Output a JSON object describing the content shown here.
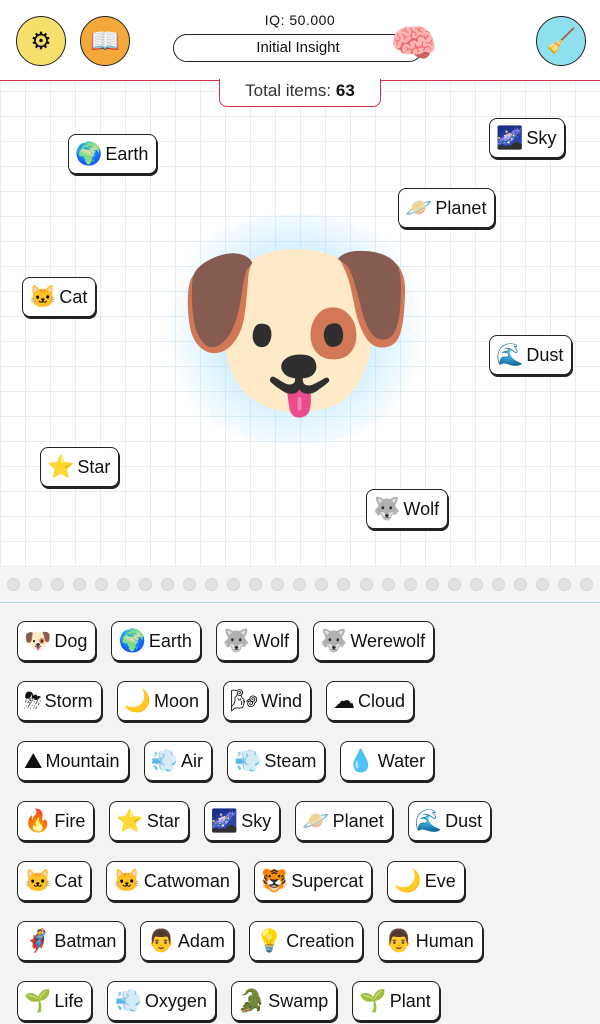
{
  "header": {
    "iq_label": "IQ: 50.000",
    "level": "Initial Insight",
    "settings_icon": "⚙",
    "book_icon": "📖",
    "brain_icon": "🧠",
    "broom_icon": "🧹",
    "colors": {
      "settings": "#f6df6a",
      "book": "#f3a93a",
      "broom": "#8fe0ee",
      "accent": "#d8304a"
    }
  },
  "total": {
    "label": "Total items:",
    "count": "63"
  },
  "canvas": {
    "center_item": {
      "name": "Dog",
      "icon": "🐶"
    },
    "items": [
      {
        "icon": "🌍",
        "label": "Earth"
      },
      {
        "icon": "🌌",
        "label": "Sky"
      },
      {
        "icon": "🪐",
        "label": "Planet"
      },
      {
        "icon": "🐱",
        "label": "Cat"
      },
      {
        "icon": "🌊",
        "label": "Dust"
      },
      {
        "icon": "⭐",
        "label": "Star"
      },
      {
        "icon": "🐺",
        "label": "Wolf"
      }
    ]
  },
  "inventory": {
    "rows": [
      [
        {
          "icon": "🐶",
          "label": "Dog"
        },
        {
          "icon": "🌍",
          "label": "Earth"
        },
        {
          "icon": "🐺",
          "label": "Wolf"
        },
        {
          "icon": "🐺",
          "label": "Werewolf"
        }
      ],
      [
        {
          "icon": "⛈",
          "label": "Storm"
        },
        {
          "icon": "🌙",
          "label": "Moon"
        },
        {
          "icon": "🌬",
          "label": "Wind"
        },
        {
          "icon": "☁",
          "label": "Cloud"
        }
      ],
      [
        {
          "icon": "⛰",
          "label": "Mountain"
        },
        {
          "icon": "💨",
          "label": "Air"
        },
        {
          "icon": "💨",
          "label": "Steam"
        },
        {
          "icon": "💧",
          "label": "Water"
        }
      ],
      [
        {
          "icon": "🔥",
          "label": "Fire"
        },
        {
          "icon": "⭐",
          "label": "Star"
        },
        {
          "icon": "🌌",
          "label": "Sky"
        },
        {
          "icon": "🪐",
          "label": "Planet"
        },
        {
          "icon": "🌊",
          "label": "Dust"
        }
      ],
      [
        {
          "icon": "🐱",
          "label": "Cat"
        },
        {
          "icon": "🐱",
          "label": "Catwoman"
        },
        {
          "icon": "🐯",
          "label": "Supercat"
        },
        {
          "icon": "🌙",
          "label": "Eve"
        }
      ],
      [
        {
          "icon": "🦸",
          "label": "Batman"
        },
        {
          "icon": "👨",
          "label": "Adam"
        },
        {
          "icon": "💡",
          "label": "Creation"
        },
        {
          "icon": "👨",
          "label": "Human"
        }
      ],
      [
        {
          "icon": "🌱",
          "label": "Life"
        },
        {
          "icon": "💨",
          "label": "Oxygen"
        },
        {
          "icon": "🐊",
          "label": "Swamp"
        },
        {
          "icon": "🌱",
          "label": "Plant"
        }
      ]
    ]
  }
}
